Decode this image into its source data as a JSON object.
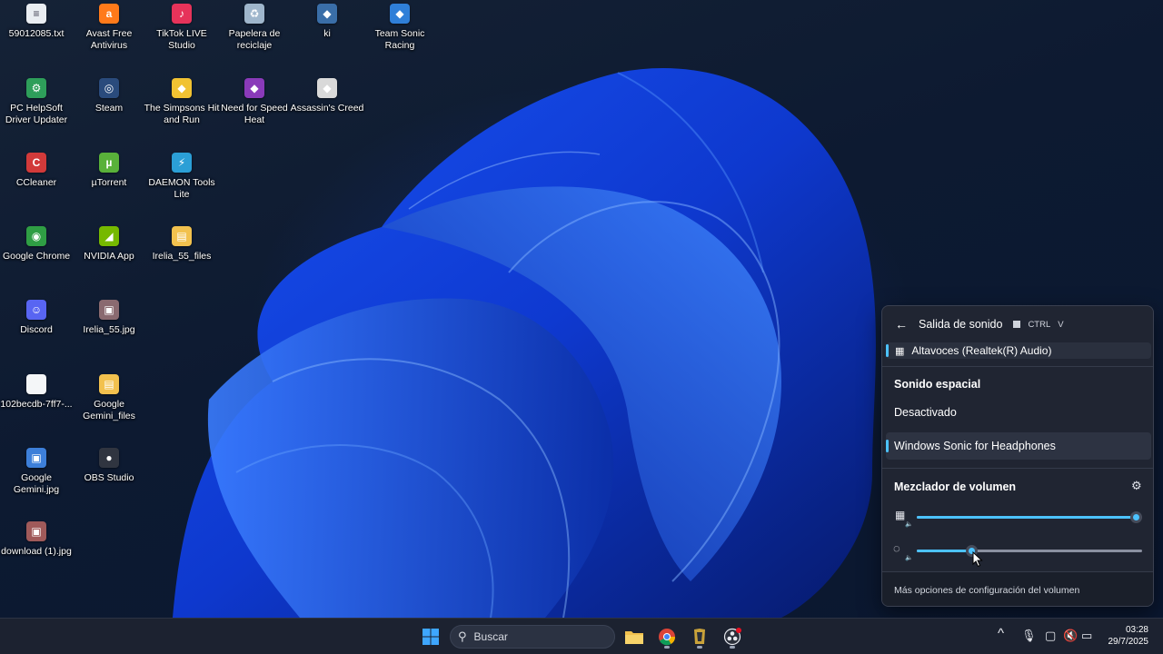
{
  "desktop": {
    "icons": [
      {
        "label": "59012085.txt",
        "icon": "text-file-icon",
        "color": "#e9edf2"
      },
      {
        "label": "Avast Free Antivirus",
        "icon": "avast-icon",
        "color": "#ff7a1a"
      },
      {
        "label": "TikTok LIVE Studio",
        "icon": "tiktok-icon",
        "color": "#e6335a"
      },
      {
        "label": "Papelera de reciclaje",
        "icon": "recycle-bin-icon",
        "color": "#9fb6cc"
      },
      {
        "label": "ki",
        "icon": "game-icon",
        "color": "#3a6ea8"
      },
      {
        "label": "Team Sonic Racing",
        "icon": "game-icon",
        "color": "#2f7fd8"
      },
      {
        "label": "PC HelpSoft Driver Updater",
        "icon": "driver-updater-icon",
        "color": "#2e9e5a"
      },
      {
        "label": "Steam",
        "icon": "steam-icon",
        "color": "#2a4b7c"
      },
      {
        "label": "The Simpsons Hit and Run",
        "icon": "game-icon",
        "color": "#f1c232"
      },
      {
        "label": "Need for Speed Heat",
        "icon": "game-icon",
        "color": "#8a3ab9"
      },
      {
        "label": "Assassin's Creed",
        "icon": "game-icon",
        "color": "#d9d9d9"
      },
      {
        "label": "CCleaner",
        "icon": "ccleaner-icon",
        "color": "#d23a3a"
      },
      {
        "label": "µTorrent",
        "icon": "utorrent-icon",
        "color": "#59b13a"
      },
      {
        "label": "DAEMON Tools Lite",
        "icon": "daemon-tools-icon",
        "color": "#2b9fd6"
      },
      {
        "label": "Google Chrome",
        "icon": "chrome-icon",
        "color": "#2f9e44"
      },
      {
        "label": "NVIDIA App",
        "icon": "nvidia-icon",
        "color": "#76b900"
      },
      {
        "label": "Irelia_55_files",
        "icon": "folder-icon",
        "color": "#f2c14e"
      },
      {
        "label": "Discord",
        "icon": "discord-icon",
        "color": "#5865f2"
      },
      {
        "label": "Irelia_55.jpg",
        "icon": "image-file-icon",
        "color": "#8a6a70"
      },
      {
        "label": "102becdb-7ff7-...",
        "icon": "blank-file-icon",
        "color": "#f4f6f8"
      },
      {
        "label": "Google Gemini_files",
        "icon": "folder-icon",
        "color": "#f2c14e"
      },
      {
        "label": "Google Gemini.jpg",
        "icon": "image-file-icon",
        "color": "#3d7fd9"
      },
      {
        "label": "OBS Studio",
        "icon": "obs-icon",
        "color": "#303540"
      },
      {
        "label": "download (1).jpg",
        "icon": "image-file-icon",
        "color": "#a05a5a"
      }
    ]
  },
  "taskbar": {
    "search_placeholder": "Buscar",
    "search_icon": "search-icon",
    "apps": [
      {
        "name": "start-icon"
      },
      {
        "name": "file-explorer-icon"
      },
      {
        "name": "chrome-icon"
      },
      {
        "name": "game-icon"
      },
      {
        "name": "obs-icon"
      }
    ],
    "tray": {
      "chevron": "^",
      "mic": "🎙",
      "clock_time": "03:28",
      "clock_date": "29/7/2025"
    }
  },
  "flyout": {
    "title": "Salida de sonido",
    "shortcut_ctrl": "CTRL",
    "shortcut_v": "V",
    "device_label": "Altavoces (Realtek(R) Audio)",
    "spatial_title": "Sonido espacial",
    "spatial_options": [
      "Desactivado",
      "Windows Sonic for Headphones"
    ],
    "spatial_selected": 1,
    "mixer_title": "Mezclador de volumen",
    "mixer_rows": [
      {
        "icon": "speaker-icon",
        "volume": 0.97
      },
      {
        "icon": "app-icon",
        "volume": 0.24
      }
    ],
    "footer_text": "Más opciones de configuración del volumen",
    "accent_color": "#4cc2ff"
  }
}
